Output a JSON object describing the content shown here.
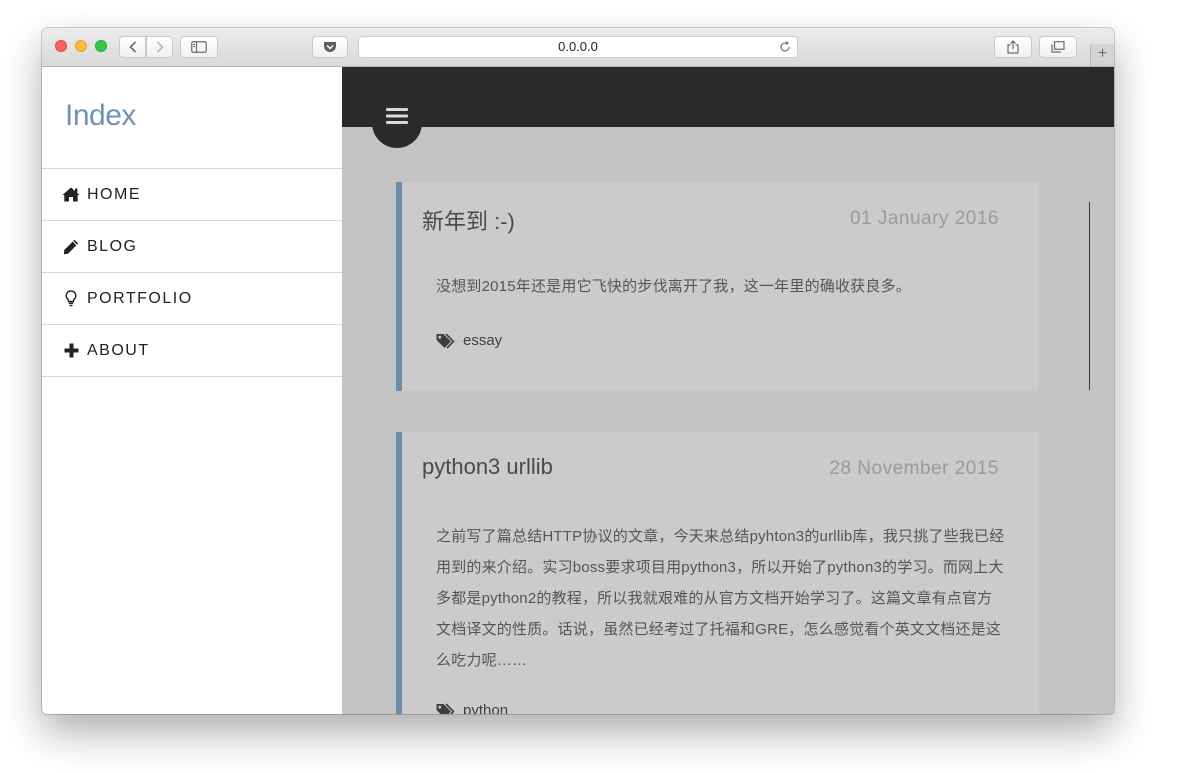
{
  "browser": {
    "address": "0.0.0.0",
    "new_tab": "+"
  },
  "sidebar": {
    "brand": "Index",
    "items": [
      {
        "label": "HOME",
        "icon": "home-icon"
      },
      {
        "label": "BLOG",
        "icon": "pencil-icon"
      },
      {
        "label": "PORTFOLIO",
        "icon": "lightbulb-icon"
      },
      {
        "label": "ABOUT",
        "icon": "plus-icon"
      }
    ]
  },
  "posts": [
    {
      "title": "新年到 :-)",
      "date": "01 January 2016",
      "excerpt": "没想到2015年还是用它飞快的步伐离开了我，这一年里的确收获良多。",
      "tag": "essay"
    },
    {
      "title": "python3 urllib",
      "date": "28 November 2015",
      "excerpt": "之前写了篇总结HTTP协议的文章，今天来总结pyhton3的urllib库，我只挑了些我已经用到的来介绍。实习boss要求项目用python3，所以开始了python3的学习。而网上大多都是python2的教程，所以我就艰难的从官方文档开始学习了。这篇文章有点官方文档译文的性质。话说，虽然已经考过了托福和GRE，怎么感觉看个英文文档还是这么吃力呢……",
      "tag": "python"
    }
  ],
  "colors": {
    "brand": "#6f93b8",
    "topbar": "#2a2a2a",
    "post_accent": "#6f8ba8"
  }
}
